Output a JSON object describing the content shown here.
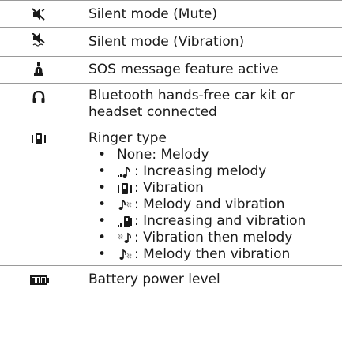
{
  "rows": [
    {
      "icon": "silent-mute-icon",
      "text": "Silent mode (Mute)"
    },
    {
      "icon": "silent-vibration-icon",
      "text": "Silent mode (Vibration)"
    },
    {
      "icon": "sos-icon",
      "text": "SOS message feature active"
    },
    {
      "icon": "headset-icon",
      "text": "Bluetooth hands-free car kit or headset connected"
    },
    {
      "icon": "ringer-vibration-icon",
      "text": "Ringer type",
      "bullets": [
        {
          "icon": "",
          "text": "None: Melody"
        },
        {
          "icon": "increasing-melody-icon",
          "text": ": Increasing melody"
        },
        {
          "icon": "vibration-icon",
          "text": ": Vibration"
        },
        {
          "icon": "melody-vibration-icon",
          "text": ": Melody and vibration"
        },
        {
          "icon": "increasing-vibration-icon",
          "text": ": Increasing and vibration"
        },
        {
          "icon": "vibration-then-melody-icon",
          "text": ": Vibration then melody"
        },
        {
          "icon": "melody-then-vibration-icon",
          "text": ": Melody then vibration"
        }
      ]
    },
    {
      "icon": "battery-icon",
      "text": "Battery power level"
    }
  ],
  "bullet_char": "•"
}
